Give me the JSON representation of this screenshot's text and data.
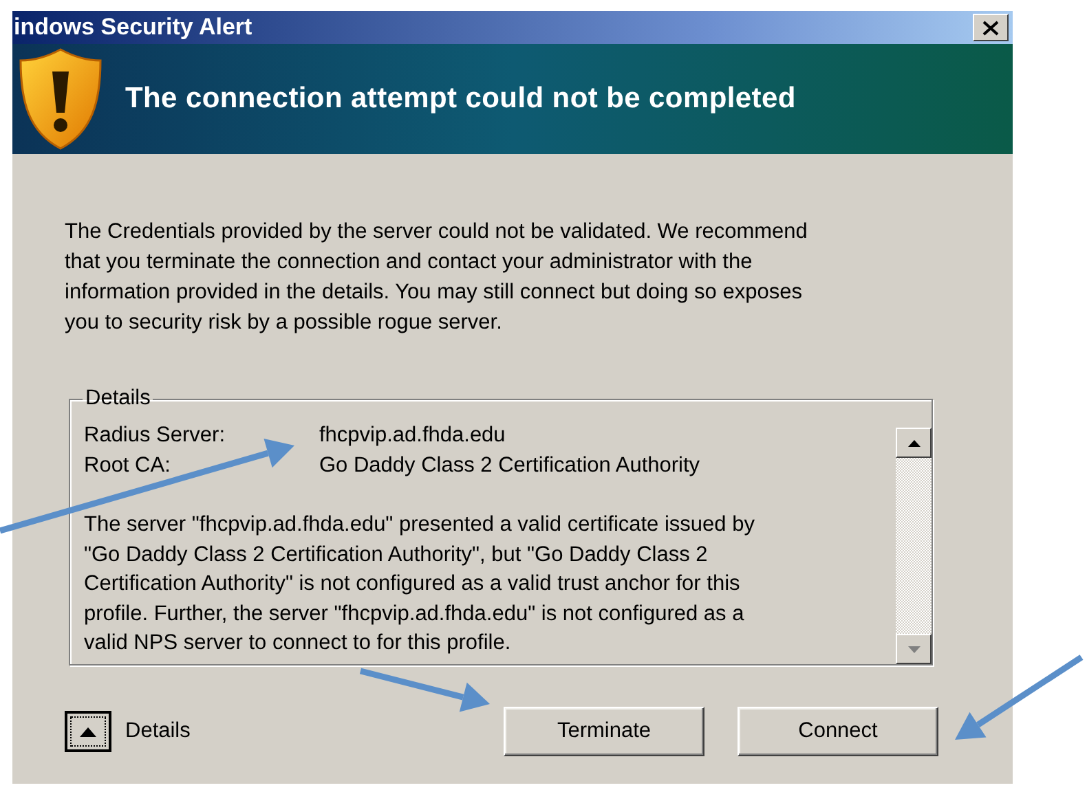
{
  "window": {
    "title": "indows Security Alert"
  },
  "banner": {
    "heading": "The connection attempt could not be completed"
  },
  "message": "The Credentials provided by the server could not be validated. We recommend\nthat you terminate the connection and contact your administrator with the\ninformation provided in the details. You may still connect but doing so exposes\nyou to security risk by a possible rogue server.",
  "details": {
    "legend": "Details",
    "fields": [
      {
        "label": "Radius Server:",
        "value": "fhcpvip.ad.fhda.edu"
      },
      {
        "label": "Root CA:",
        "value": "Go Daddy Class 2 Certification Authority"
      }
    ],
    "description": "The server \"fhcpvip.ad.fhda.edu\" presented a valid certificate issued by\n\"Go Daddy Class 2 Certification Authority\", but \"Go Daddy Class 2\nCertification Authority\" is not configured as a valid trust anchor for this\nprofile. Further, the server \"fhcpvip.ad.fhda.edu\" is not configured as a\nvalid NPS server to connect to for this profile."
  },
  "footer": {
    "toggle": {
      "label": "Details",
      "expanded": true
    },
    "buttons": [
      {
        "label": "Terminate"
      },
      {
        "label": "Connect"
      }
    ]
  }
}
